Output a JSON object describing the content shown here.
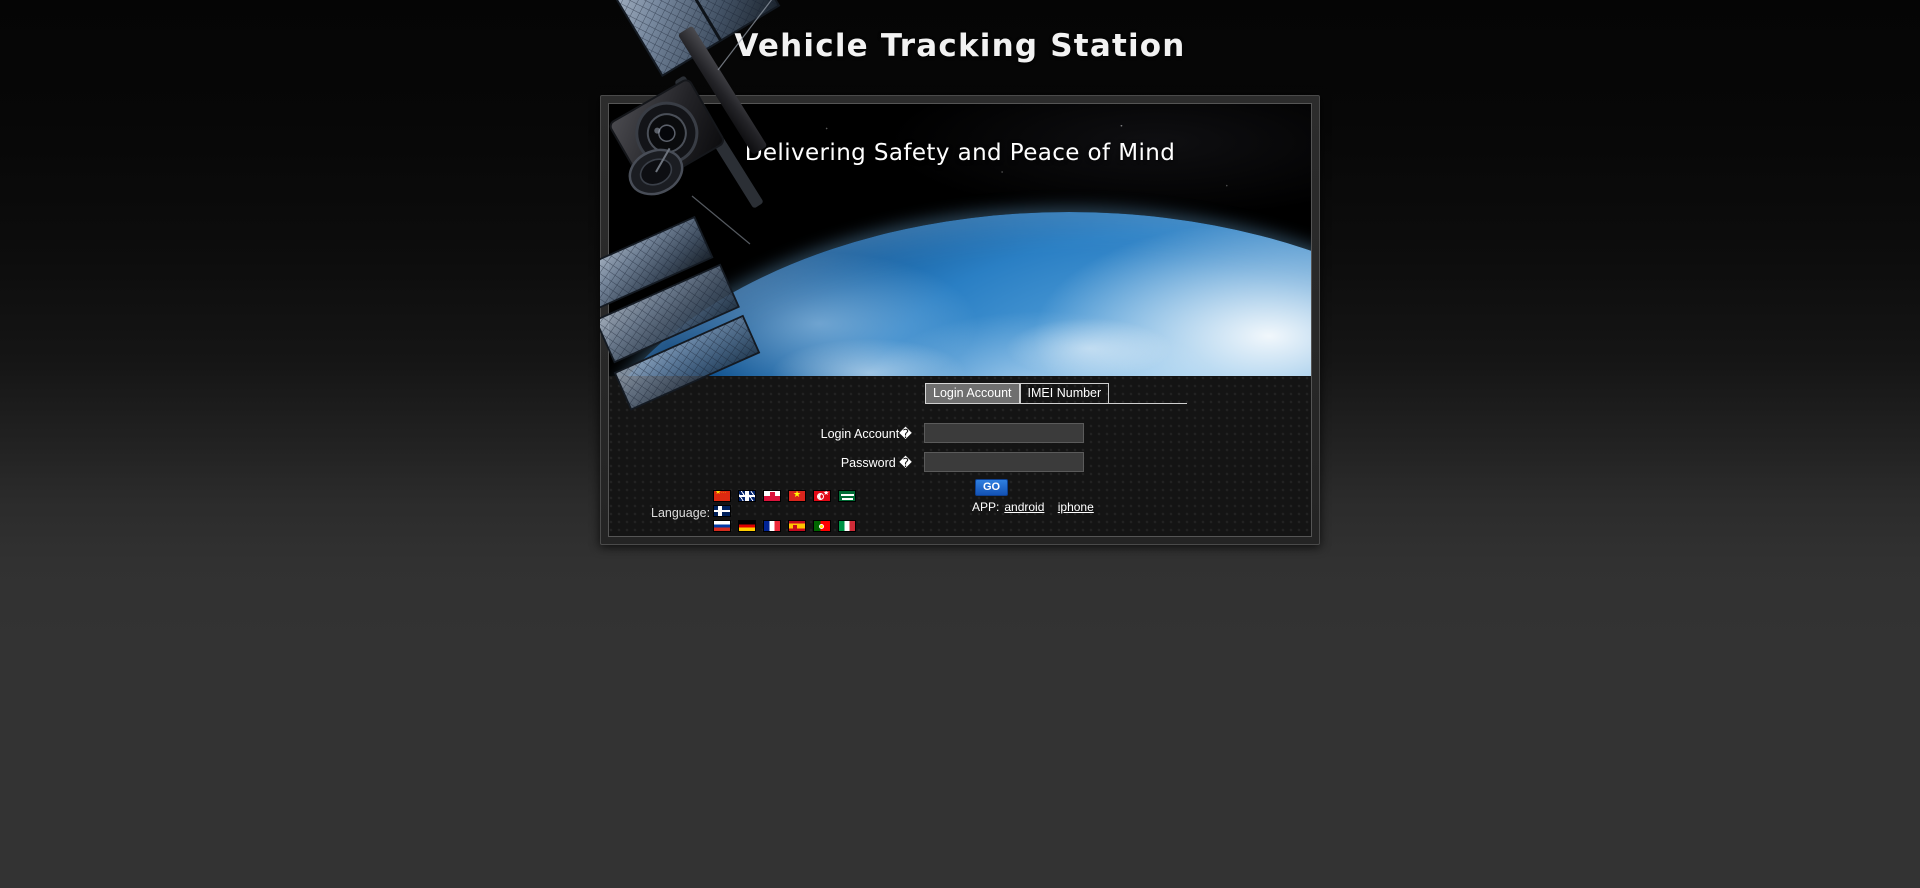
{
  "page": {
    "title": "Vehicle Tracking Station"
  },
  "hero": {
    "tagline": "Delivering Safety and Peace of Mind",
    "image_name": "satellite-over-earth"
  },
  "login": {
    "tabs": [
      {
        "id": "login-account",
        "label": "Login Account",
        "active": true
      },
      {
        "id": "imei-number",
        "label": "IMEI Number",
        "active": false
      }
    ],
    "fields": {
      "account": {
        "label": "Login Account�",
        "value": "",
        "placeholder": ""
      },
      "password": {
        "label": "Password �",
        "value": "",
        "placeholder": ""
      }
    },
    "submit_label": "GO",
    "submit_color": "#1e68cf",
    "app": {
      "label": "APP:",
      "links": [
        {
          "id": "android",
          "label": "android"
        },
        {
          "id": "iphone",
          "label": "iphone"
        }
      ]
    }
  },
  "language": {
    "label": "Language:",
    "rows": [
      [
        {
          "code": "cn",
          "name": "china-flag"
        },
        {
          "code": "gb",
          "name": "united-kingdom-flag"
        },
        {
          "code": "pl",
          "name": "poland-flag"
        },
        {
          "code": "vn",
          "name": "vietnam-flag"
        },
        {
          "code": "tr",
          "name": "turkey-flag"
        },
        {
          "code": "sa",
          "name": "saudi-arabia-flag"
        }
      ],
      [
        {
          "code": "no",
          "name": "norway-flag"
        }
      ],
      [
        {
          "code": "ru",
          "name": "russia-flag"
        },
        {
          "code": "de",
          "name": "germany-flag"
        },
        {
          "code": "fr",
          "name": "france-flag"
        },
        {
          "code": "es",
          "name": "spain-flag"
        },
        {
          "code": "pt",
          "name": "portugal-flag"
        },
        {
          "code": "it",
          "name": "italy-flag"
        }
      ]
    ]
  },
  "theme": {
    "page_background": "#333333",
    "panel_background": "#242424",
    "panel_border": "#4a4a4a",
    "text_color": "#ffffff",
    "accent": "#1e68cf"
  }
}
